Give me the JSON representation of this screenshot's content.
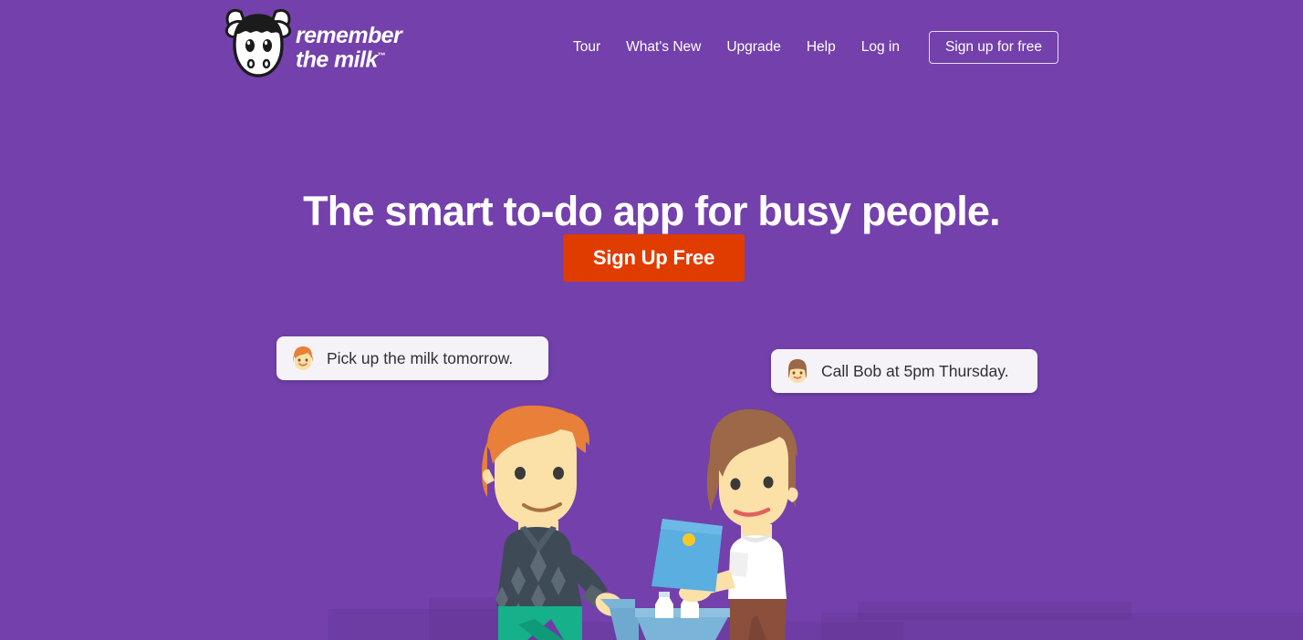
{
  "site": {
    "brand_name": "remember the milk",
    "brand_line1": "remember",
    "brand_line2": "the milk",
    "trademark": "™",
    "logo_icon": "cow-head-icon",
    "background_color": "#7340ac",
    "accent_color": "#e03c00"
  },
  "nav": {
    "items": [
      {
        "label": "Tour"
      },
      {
        "label": "What's New"
      },
      {
        "label": "Upgrade"
      },
      {
        "label": "Help"
      },
      {
        "label": "Log in"
      }
    ],
    "cta_label": "Sign up for free"
  },
  "hero": {
    "headline": "The smart to-do app for busy people.",
    "cta_label": "Sign Up Free"
  },
  "task_bubbles": [
    {
      "text": "Pick up the milk tomorrow.",
      "avatar": "male-avatar-icon",
      "hair_color": "#e8803a",
      "skin_color": "#fbe0a8"
    },
    {
      "text": "Call Bob at 5pm Thursday.",
      "avatar": "female-avatar-icon",
      "hair_color": "#9c6848",
      "skin_color": "#fbe0a8"
    }
  ],
  "illustration": {
    "name": "shopping-couple-illustration",
    "man": {
      "hair_color": "#e8803a",
      "skin_color": "#fbe0a8",
      "sweater_color": "#3e4b56",
      "pants_color": "#16b08a"
    },
    "woman": {
      "hair_color": "#9c6848",
      "skin_color": "#fbe0a8",
      "shirt_color": "#ffffff",
      "pants_color": "#8c4f3c",
      "tablet_color": "#5aaee0",
      "tablet_button_color": "#f2c929"
    },
    "cart_color": "#7ab4d8",
    "milk_bottles": 2,
    "bottle_color": "#ffffff"
  }
}
